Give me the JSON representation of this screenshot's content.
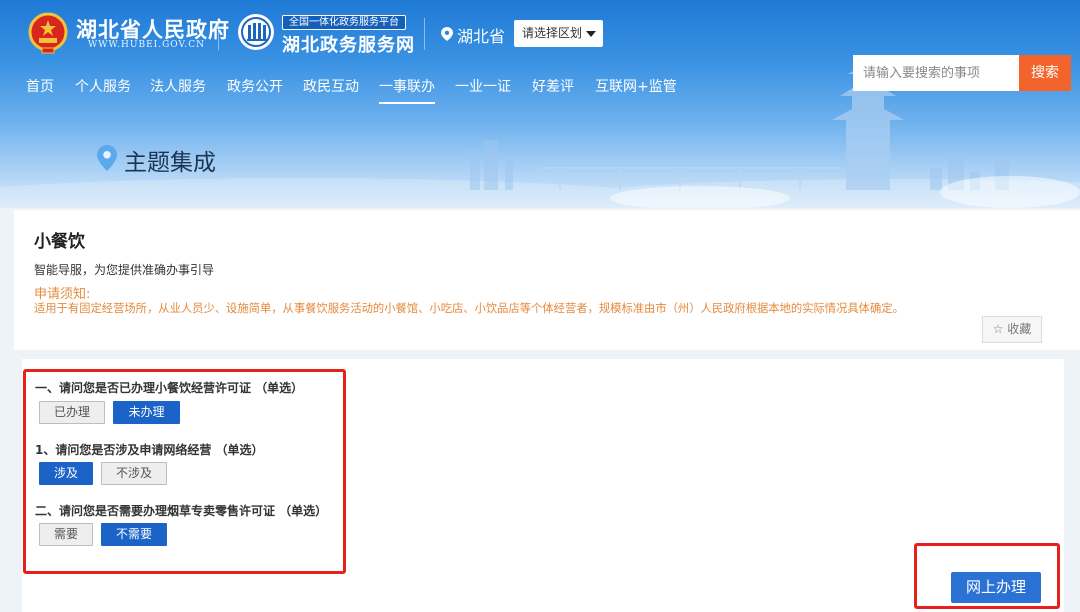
{
  "header": {
    "gov_title": "湖北省人民政府",
    "gov_url": "WWW.HUBEI.GOV.CN",
    "platform_tag": "全国一体化政务服务平台",
    "platform_name": "湖北政务服务网",
    "province": "湖北省",
    "region_select_label": "请选择区划",
    "search_placeholder": "请输入要搜索的事项",
    "search_button": "搜索"
  },
  "nav": {
    "items": [
      "首页",
      "个人服务",
      "法人服务",
      "政务公开",
      "政民互动",
      "一事联办",
      "一业一证",
      "好差评",
      "互联网+监管"
    ],
    "active": "一事联办"
  },
  "banner": {
    "title": "主题集成"
  },
  "item": {
    "title": "小餐饮",
    "subtitle": "智能导服，为您提供准确办事引导",
    "notice_label": "申请须知:",
    "notice_text": "适用于有固定经营场所，从业人员少、设施简单，从事餐饮服务活动的小餐馆、小吃店、小饮品店等个体经营者，规模标准由市（州）人民政府根据本地的实际情况具体确定。",
    "favorite_label": "收藏"
  },
  "questions": [
    {
      "title": "一、请问您是否已办理小餐饮经营许可证 （单选）",
      "options": [
        "已办理",
        "未办理"
      ],
      "selected": "未办理"
    },
    {
      "title": "1、请问您是否涉及申请网络经营 （单选）",
      "options": [
        "涉及",
        "不涉及"
      ],
      "selected": "涉及"
    },
    {
      "title": "二、请问您是否需要办理烟草专卖零售许可证 （单选）",
      "options": [
        "需要",
        "不需要"
      ],
      "selected": "不需要"
    }
  ],
  "submit_label": "网上办理",
  "colors": {
    "header_blue": "#1f7ad6",
    "search_orange": "#f2642c",
    "selected_blue": "#1c63c7",
    "notice_orange": "#e58a3c",
    "highlight_red": "#e6201a"
  }
}
